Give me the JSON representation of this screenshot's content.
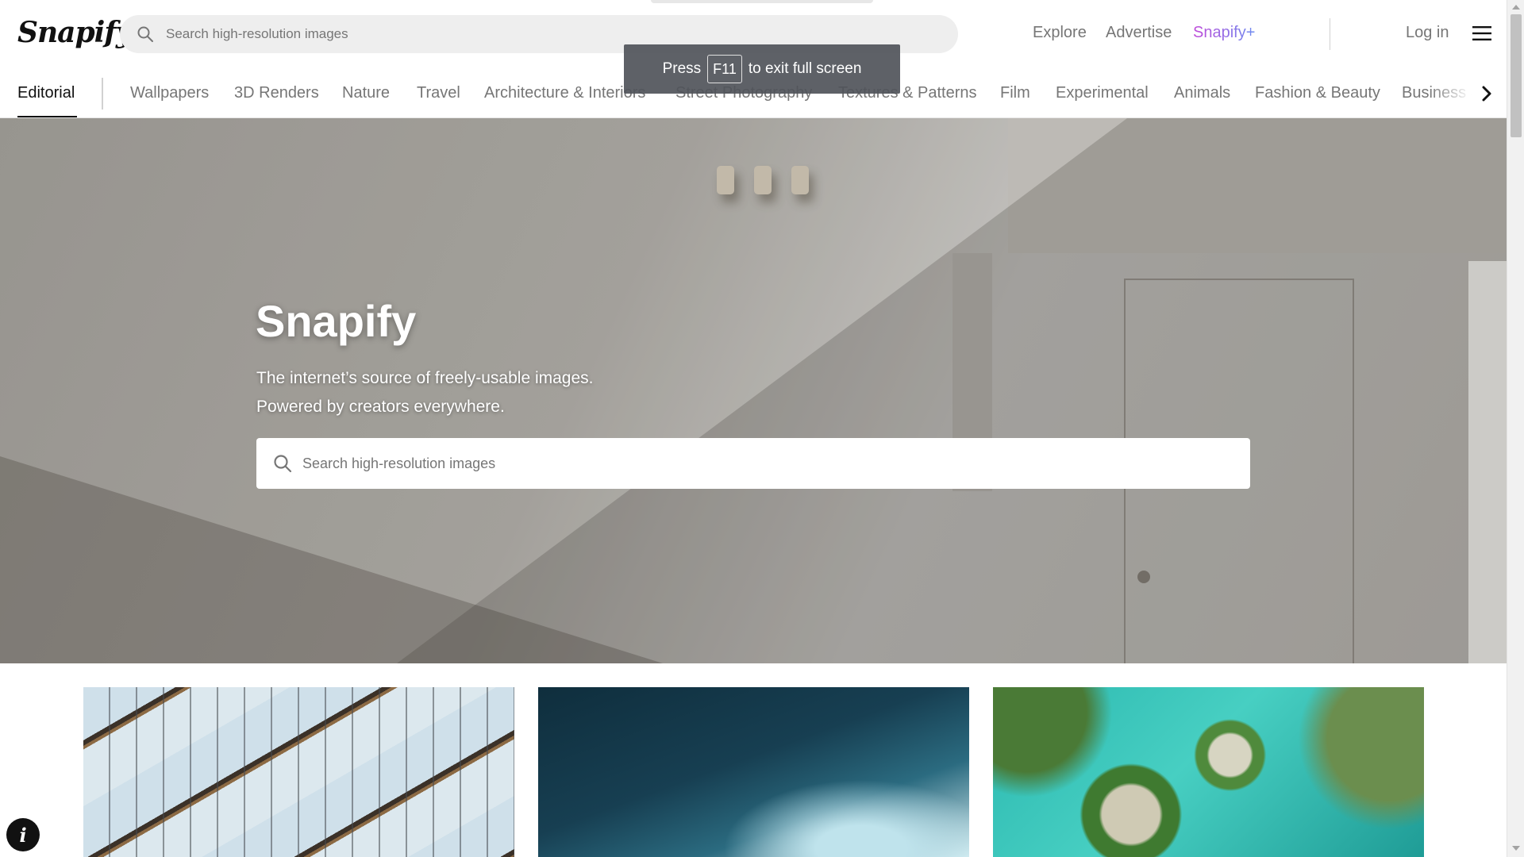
{
  "header": {
    "logo": "Snapify",
    "search_placeholder": "Search high-resolution images",
    "nav": {
      "explore": "Explore",
      "advertise": "Advertise",
      "plus": "Snapify+",
      "login": "Log in"
    },
    "icons": {
      "search": "search-icon",
      "menu": "hamburger-menu-icon"
    }
  },
  "categories": {
    "active": "Editorial",
    "items": [
      "Wallpapers",
      "3D Renders",
      "Nature",
      "Travel",
      "Architecture & Interiors",
      "Street Photography",
      "Textures & Patterns",
      "Film",
      "Experimental",
      "Animals",
      "Fashion & Beauty",
      "Business & Work"
    ],
    "scroll_icon": "chevron-right-icon"
  },
  "hero": {
    "title": "Snapify",
    "subtitle_line1": "The internet’s source of freely-usable images.",
    "subtitle_line2": "Powered by creators everywhere.",
    "search_placeholder": "Search high-resolution images"
  },
  "fullscreen_toast": {
    "press": "Press",
    "key": "F11",
    "message": "to exit full screen"
  },
  "photos": [
    {
      "subject": "glass building facade"
    },
    {
      "subject": "ocean wave"
    },
    {
      "subject": "aerial tropical lagoon"
    }
  ],
  "info_button": {
    "icon": "info-icon"
  },
  "colors": {
    "text_primary": "#111111",
    "text_secondary": "#767676",
    "plus_gradient_start": "#c04ad9",
    "plus_gradient_end": "#6e8cf0",
    "search_bg": "#eeeeee",
    "toast_bg": "#50545a"
  }
}
